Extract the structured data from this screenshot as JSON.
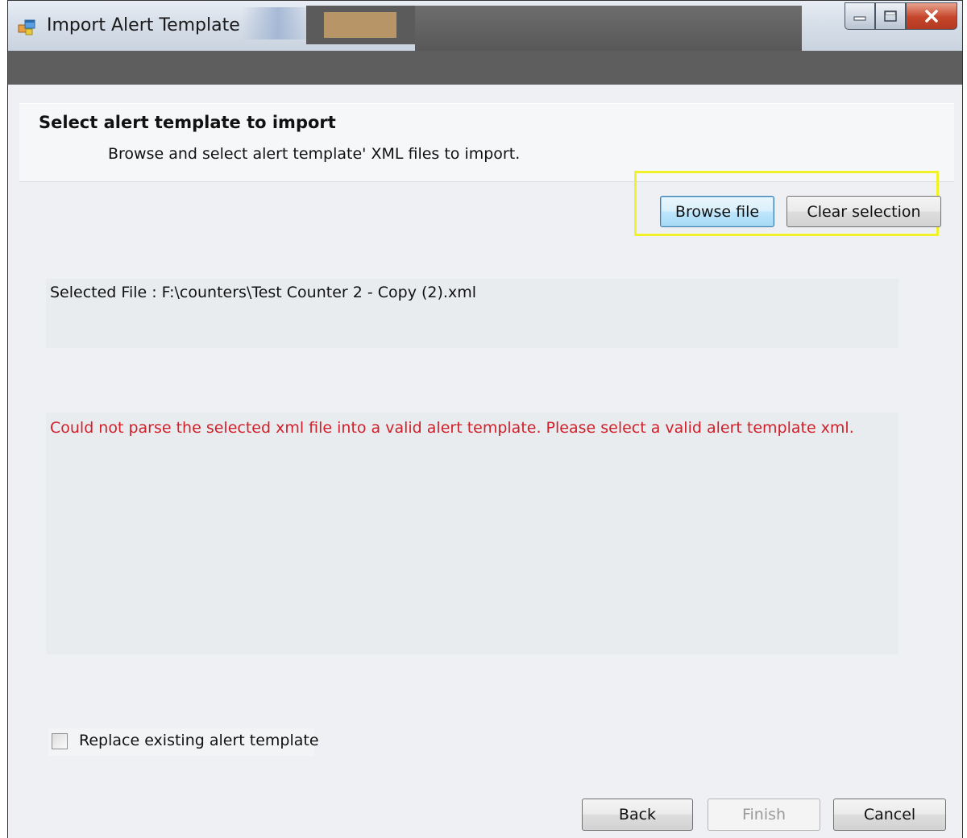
{
  "window": {
    "title": "Import Alert Template",
    "icons": {
      "app": "app-window-icon",
      "minimize": "minimize-icon",
      "maximize": "maximize-icon",
      "close": "close-icon"
    }
  },
  "header": {
    "title": "Select alert template to import",
    "subtitle": "Browse and select alert template' XML files to import."
  },
  "toolbar": {
    "browse_label": "Browse file",
    "clear_label": "Clear selection"
  },
  "selection": {
    "file_text": "Selected File : F:\\counters\\Test Counter 2 - Copy (2).xml"
  },
  "error": {
    "message": "Could not parse the selected xml file into a valid alert template. Please select a valid alert template xml."
  },
  "options": {
    "replace_label": "Replace existing alert template",
    "replace_checked": false
  },
  "footer": {
    "back_label": "Back",
    "finish_label": "Finish",
    "cancel_label": "Cancel"
  },
  "colors": {
    "error_text": "#d0202a",
    "highlight_border": "#f1f12a",
    "close_button": "#c5452a"
  }
}
